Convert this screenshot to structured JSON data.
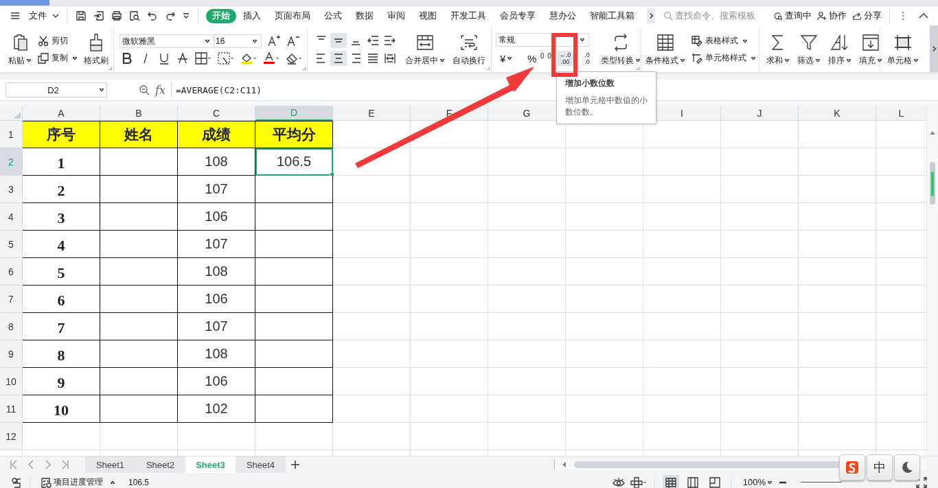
{
  "menu": {
    "file": "文件",
    "tabs": [
      {
        "label": "开始",
        "selected": true
      },
      {
        "label": "插入",
        "selected": false
      },
      {
        "label": "页面布局",
        "selected": false
      },
      {
        "label": "公式",
        "selected": false
      },
      {
        "label": "数据",
        "selected": false
      },
      {
        "label": "审阅",
        "selected": false
      },
      {
        "label": "视图",
        "selected": false
      },
      {
        "label": "开发工具",
        "selected": false
      },
      {
        "label": "会员专享",
        "selected": false
      },
      {
        "label": "慧办公",
        "selected": false
      },
      {
        "label": "智能工具箱",
        "selected": false
      }
    ],
    "search": {
      "placeholder": "查找命令、搜索模板"
    },
    "actions": [
      "查询中",
      "协作",
      "分享"
    ]
  },
  "ribbon": {
    "paste": "粘贴",
    "cut": "剪切",
    "copy": "复制",
    "format_painter": "格式刷",
    "font": "微软雅黑",
    "font_size": "16",
    "merge": "合并居中",
    "wrap": "自动换行",
    "number_format": "常规",
    "currency": "¥",
    "percent": "%",
    "thousands": "0 0",
    "decimal_buttons": [
      {
        "top": "←.0",
        "bottom": ".00",
        "hovered": true
      },
      {
        "top": ".0",
        "bottom": ".0",
        "hovered": false
      }
    ],
    "convert": "类型转换",
    "conditional": "条件格式",
    "table_style": "表格样式",
    "cell_style": "单元格样式",
    "sum": "求和",
    "filter": "筛选",
    "sort": "排序",
    "fill": "填充",
    "cells": "单元格"
  },
  "tooltip": {
    "title": "增加小数位数",
    "body": "增加单元格中数值的小数位数。"
  },
  "formula_bar": {
    "cell": "D2",
    "fx": "fx",
    "formula": "=AVERAGE(C2:C11)"
  },
  "sheet": {
    "columns": [
      {
        "label": "A",
        "selected": false
      },
      {
        "label": "B",
        "selected": false
      },
      {
        "label": "C",
        "selected": false
      },
      {
        "label": "D",
        "selected": true
      },
      {
        "label": "E",
        "selected": false
      },
      {
        "label": "F",
        "selected": false
      },
      {
        "label": "G",
        "selected": false
      },
      {},
      {
        "label": "I",
        "selected": false
      },
      {
        "label": "J",
        "selected": false
      },
      {
        "label": "K",
        "selected": false
      },
      {
        "label": "L",
        "selected": false
      }
    ],
    "rows": [
      {
        "label": "1",
        "selected": false,
        "cells": [
          {
            "kind": "header",
            "text": "序号",
            "selected": false
          },
          {
            "kind": "header",
            "text": "姓名",
            "selected": false
          },
          {
            "kind": "header",
            "text": "成绩",
            "selected": false
          },
          {
            "kind": "header",
            "text": "平均分",
            "selected": false
          }
        ]
      },
      {
        "label": "2",
        "selected": true,
        "cells": [
          {
            "kind": "index",
            "text": "1",
            "selected": false
          },
          {
            "kind": "blank",
            "selected": false
          },
          {
            "kind": "number",
            "text": "108",
            "selected": false
          },
          {
            "kind": "number",
            "text": "106.5",
            "selected": true
          }
        ]
      },
      {
        "label": "3",
        "selected": false,
        "cells": [
          {
            "kind": "index",
            "text": "2",
            "selected": false
          },
          {
            "kind": "blank",
            "selected": false
          },
          {
            "kind": "number",
            "text": "107",
            "selected": false
          },
          {
            "kind": "blank",
            "selected": false
          }
        ]
      },
      {
        "label": "4",
        "selected": false,
        "cells": [
          {
            "kind": "index",
            "text": "3",
            "selected": false
          },
          {
            "kind": "blank",
            "selected": false
          },
          {
            "kind": "number",
            "text": "106",
            "selected": false
          },
          {
            "kind": "blank",
            "selected": false
          }
        ]
      },
      {
        "label": "5",
        "selected": false,
        "cells": [
          {
            "kind": "index",
            "text": "4",
            "selected": false
          },
          {
            "kind": "blank",
            "selected": false
          },
          {
            "kind": "number",
            "text": "107",
            "selected": false
          },
          {
            "kind": "blank",
            "selected": false
          }
        ]
      },
      {
        "label": "6",
        "selected": false,
        "cells": [
          {
            "kind": "index",
            "text": "5",
            "selected": false
          },
          {
            "kind": "blank",
            "selected": false
          },
          {
            "kind": "number",
            "text": "108",
            "selected": false
          },
          {
            "kind": "blank",
            "selected": false
          }
        ]
      },
      {
        "label": "7",
        "selected": false,
        "cells": [
          {
            "kind": "index",
            "text": "6",
            "selected": false
          },
          {
            "kind": "blank",
            "selected": false
          },
          {
            "kind": "number",
            "text": "106",
            "selected": false
          },
          {
            "kind": "blank",
            "selected": false
          }
        ]
      },
      {
        "label": "8",
        "selected": false,
        "cells": [
          {
            "kind": "index",
            "text": "7",
            "selected": false
          },
          {
            "kind": "blank",
            "selected": false
          },
          {
            "kind": "number",
            "text": "107",
            "selected": false
          },
          {
            "kind": "blank",
            "selected": false
          }
        ]
      },
      {
        "label": "9",
        "selected": false,
        "cells": [
          {
            "kind": "index",
            "text": "8",
            "selected": false
          },
          {
            "kind": "blank",
            "selected": false
          },
          {
            "kind": "number",
            "text": "108",
            "selected": false
          },
          {
            "kind": "blank",
            "selected": false
          }
        ]
      },
      {
        "label": "10",
        "selected": false,
        "cells": [
          {
            "kind": "index",
            "text": "9",
            "selected": false
          },
          {
            "kind": "blank",
            "selected": false
          },
          {
            "kind": "number",
            "text": "106",
            "selected": false
          },
          {
            "kind": "blank",
            "selected": false
          }
        ]
      },
      {
        "label": "11",
        "selected": false,
        "cells": [
          {
            "kind": "index",
            "text": "10",
            "selected": false
          },
          {
            "kind": "blank",
            "selected": false
          },
          {
            "kind": "number",
            "text": "102",
            "selected": false
          },
          {
            "kind": "blank",
            "selected": false
          }
        ]
      },
      {
        "label": "12",
        "selected": false,
        "cells": []
      }
    ]
  },
  "sheet_tabs": [
    {
      "label": "Sheet1",
      "selected": false
    },
    {
      "label": "Sheet2",
      "selected": false
    },
    {
      "label": "Sheet3",
      "selected": true
    },
    {
      "label": "Sheet4",
      "selected": false
    }
  ],
  "status_bar": {
    "document": "项目进度管理",
    "value": "106.5",
    "zoom": "100%",
    "view_modes": [
      {
        "selected": true
      },
      {
        "selected": false
      },
      {
        "selected": false
      }
    ]
  },
  "ime": {
    "label": "中"
  }
}
